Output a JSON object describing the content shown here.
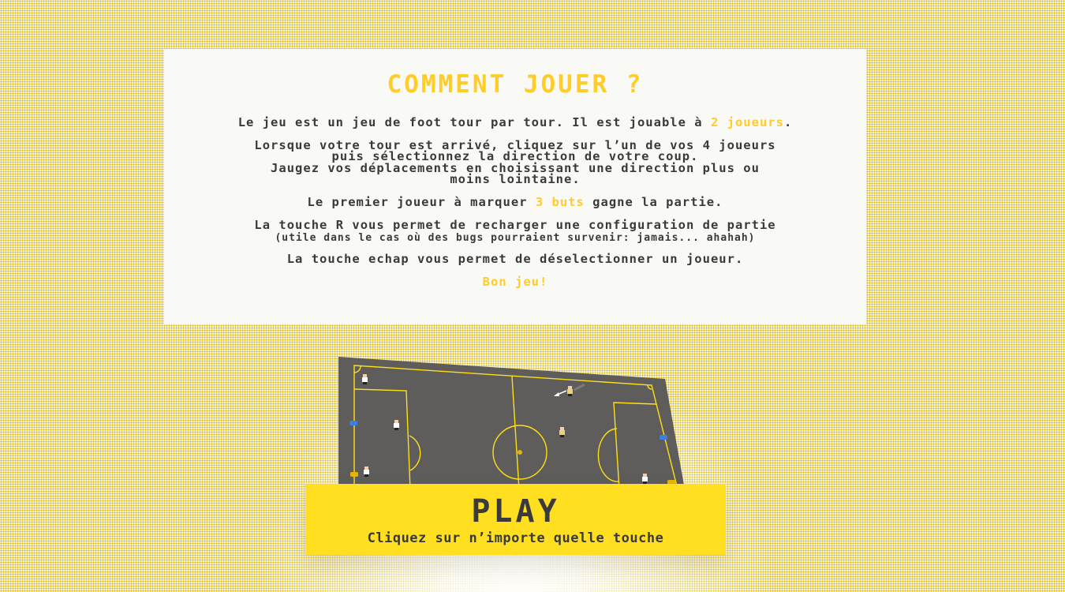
{
  "instructions": {
    "title": "COMMENT JOUER ?",
    "p1_text": "Le jeu est un jeu de foot tour par tour. Il est jouable à ",
    "p1_highlight": "2 joueurs",
    "p1_end": ".",
    "p2_line1": "Lorsque votre tour est arrivé, cliquez sur l’un de vos 4 joueurs",
    "p2_line2": "puis sélectionnez la direction de votre coup.",
    "p2_line3": "Jaugez vos déplacements en choisissant une direction plus ou",
    "p2_line4": "moins lointaine.",
    "p3_text": "Le premier joueur à marquer ",
    "p3_highlight": "3 buts",
    "p3_end": " gagne la partie.",
    "p4_line1": "La touche R vous permet de recharger une configuration de partie",
    "p4_line2": "(utile dans le cas où des bugs pourraient survenir: jamais... ahahah)",
    "p5_text": "La touche echap vous permet de déselectionner un joueur.",
    "p6_text": "Bon jeu!"
  },
  "play_button": {
    "label": "PLAY",
    "subtitle": "Cliquez sur n’importe quelle touche"
  },
  "colors": {
    "accent": "#ffcc2a",
    "play_bg": "#ffdf1f",
    "text": "#3a3a3a",
    "pitch": "#5e5d5c",
    "pitch_lines": "#ffe014",
    "team_blue": "#3b7fe0",
    "team_yellow": "#e8b400"
  }
}
